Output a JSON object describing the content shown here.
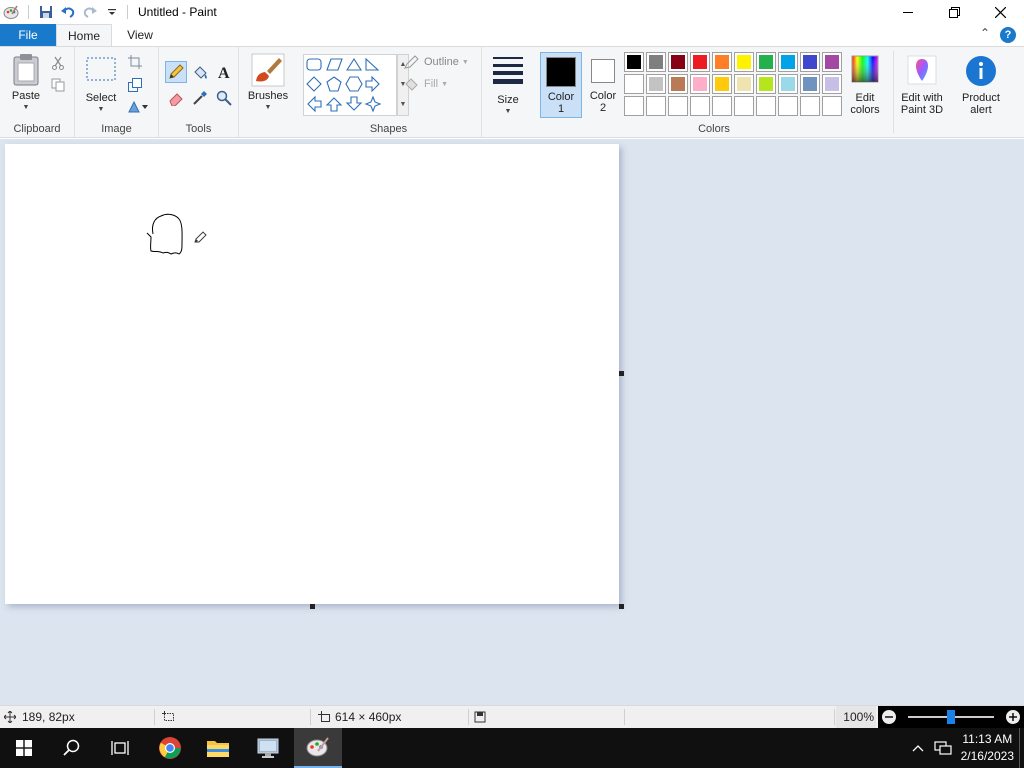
{
  "window": {
    "title": "Untitled - Paint"
  },
  "menu": {
    "file": "File",
    "tabs": [
      "Home",
      "View"
    ]
  },
  "ribbon": {
    "clipboard": {
      "label": "Clipboard",
      "paste": "Paste"
    },
    "image": {
      "label": "Image",
      "select": "Select"
    },
    "tools": {
      "label": "Tools"
    },
    "brushes": {
      "label": "Brushes"
    },
    "shapes": {
      "label": "Shapes",
      "outline": "Outline",
      "fill": "Fill"
    },
    "size": {
      "label": "Size"
    },
    "color1": {
      "label": "Color\n1",
      "line1": "Color",
      "line2": "1",
      "value": "#000000"
    },
    "color2": {
      "line1": "Color",
      "line2": "2",
      "value": "#ffffff"
    },
    "colors": {
      "label": "Colors",
      "edit_line1": "Edit",
      "edit_line2": "colors"
    },
    "paint3d": {
      "line1": "Edit with",
      "line2": "Paint 3D"
    },
    "alert": {
      "line1": "Product",
      "line2": "alert"
    }
  },
  "palette": {
    "row1": [
      "#000000",
      "#7f7f7f",
      "#880015",
      "#ed1c24",
      "#ff7f27",
      "#fff200",
      "#22b14c",
      "#00a2e8",
      "#3f48cc",
      "#a349a4"
    ],
    "row2": [
      "#ffffff",
      "#c3c3c3",
      "#b97a57",
      "#ffaec9",
      "#ffc90e",
      "#efe4b0",
      "#b5e61d",
      "#99d9ea",
      "#7092be",
      "#c8bfe7"
    ],
    "row3": [
      "",
      "",
      "",
      "",
      "",
      "",
      "",
      "",
      "",
      ""
    ]
  },
  "status": {
    "cursor_pos": "189, 82px",
    "canvas_size": "614 × 460px",
    "zoom": "100%",
    "zoom_fraction": 0.5
  },
  "taskbar": {
    "time": "11:13 AM",
    "date": "2/16/2023"
  }
}
